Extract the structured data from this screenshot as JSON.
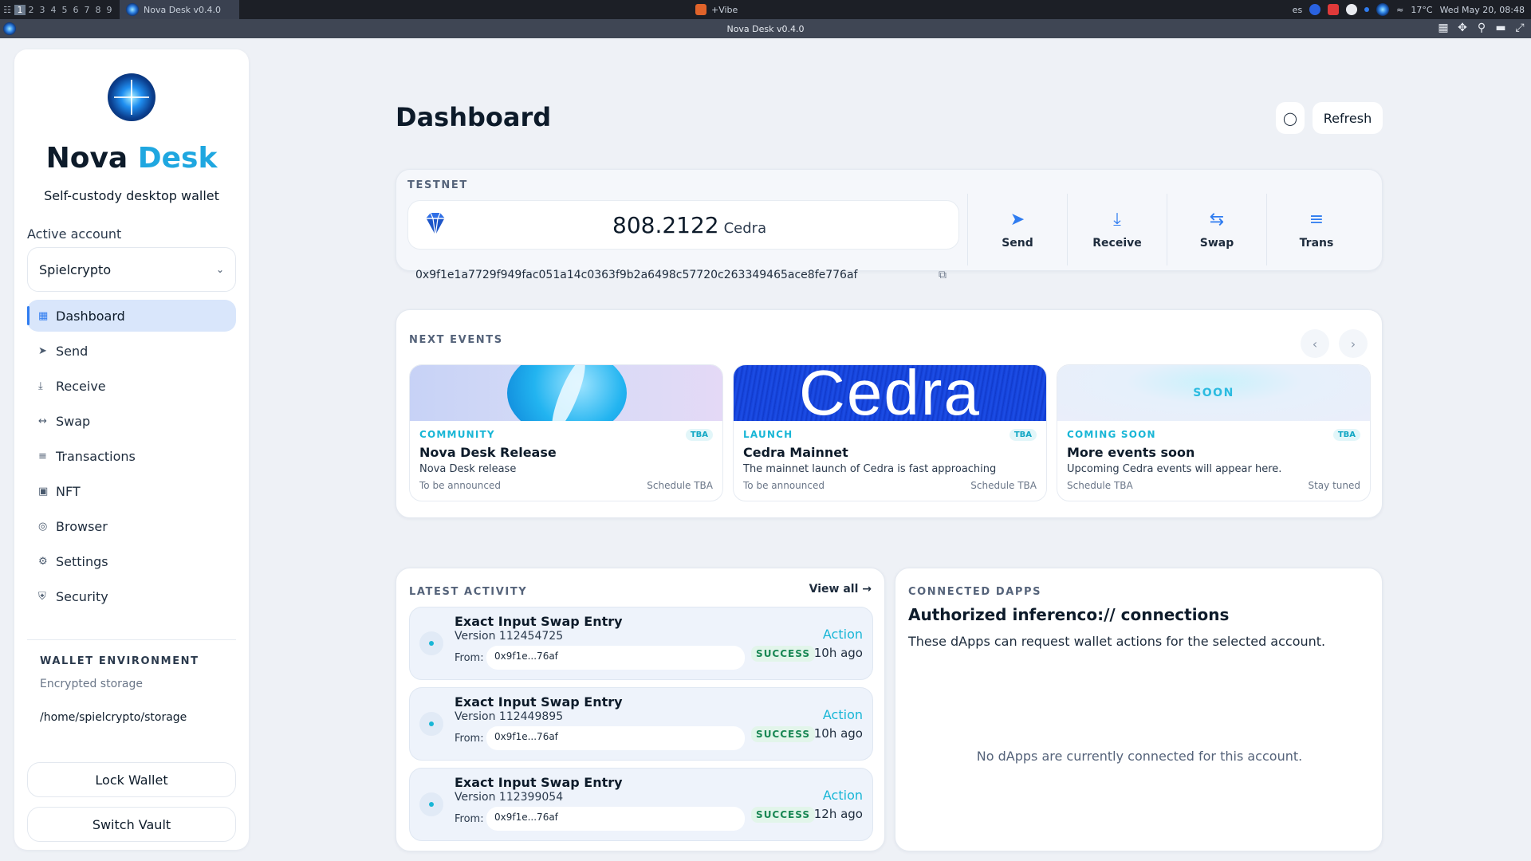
{
  "system": {
    "workspaces": [
      "1",
      "2",
      "3",
      "4",
      "5",
      "6",
      "7",
      "8",
      "9"
    ],
    "window_title": "Nova Desk v0.4.0",
    "center_app": "+Vibe",
    "lang": "es",
    "temp": "17°C",
    "datetime": "Wed May 20, 08:48"
  },
  "titlebar": {
    "title": "Nova Desk v0.4.0"
  },
  "sidebar": {
    "brand_main": "Nova ",
    "brand_accent": "Desk",
    "tagline": "Self-custody desktop wallet",
    "account_label": "Active account",
    "account_value": "Spielcrypto",
    "nav": [
      {
        "label": "Dashboard",
        "icon": "grid-icon"
      },
      {
        "label": "Send",
        "icon": "send-icon"
      },
      {
        "label": "Receive",
        "icon": "download-icon"
      },
      {
        "label": "Swap",
        "icon": "swap-icon"
      },
      {
        "label": "Transactions",
        "icon": "list-icon"
      },
      {
        "label": "NFT",
        "icon": "image-icon"
      },
      {
        "label": "Browser",
        "icon": "globe-icon"
      },
      {
        "label": "Settings",
        "icon": "gear-icon"
      },
      {
        "label": "Security",
        "icon": "shield-icon"
      }
    ],
    "env_label": "WALLET ENVIRONMENT",
    "env_sub": "Encrypted storage",
    "env_path": "/home/spielcrypto/storage",
    "lock_label": "Lock Wallet",
    "switch_label": "Switch Vault"
  },
  "header": {
    "title": "Dashboard",
    "refresh_label": "Refresh"
  },
  "network": {
    "label": "TESTNET",
    "balance": "808.2122",
    "unit": "Cedra",
    "address": "0x9f1e1a7729f949fac051a14c0363f9b2a6498c57720c263349465ace8fe776af",
    "actions": [
      {
        "label": "Send",
        "icon": "send-icon"
      },
      {
        "label": "Receive",
        "icon": "download-icon"
      },
      {
        "label": "Swap",
        "icon": "swap-icon"
      },
      {
        "label": "Trans",
        "icon": "list-icon"
      }
    ]
  },
  "events": {
    "label": "NEXT EVENTS",
    "items": [
      {
        "category": "COMMUNITY",
        "badge": "TBA",
        "title": "Nova Desk Release",
        "desc": "Nova Desk release",
        "date": "To be announced",
        "schedule": "Schedule TBA"
      },
      {
        "category": "LAUNCH",
        "badge": "TBA",
        "title": "Cedra Mainnet",
        "desc": "The mainnet launch of Cedra is fast approaching",
        "date": "To be announced",
        "schedule": "Schedule TBA",
        "banner_text": "Cedra"
      },
      {
        "category": "COMING SOON",
        "badge": "TBA",
        "title": "More events soon",
        "desc": "Upcoming Cedra events will appear here.",
        "date": "Schedule TBA",
        "schedule": "Stay tuned",
        "banner_text": "SOON"
      }
    ]
  },
  "activity": {
    "label": "LATEST ACTIVITY",
    "view_all": "View all",
    "items": [
      {
        "title": "Exact Input Swap Entry",
        "version": "Version 112454725",
        "from_label": "From:",
        "from": "0x9f1e...76af",
        "action": "Action",
        "status": "SUCCESS",
        "ago": "10h ago"
      },
      {
        "title": "Exact Input Swap Entry",
        "version": "Version 112449895",
        "from_label": "From:",
        "from": "0x9f1e...76af",
        "action": "Action",
        "status": "SUCCESS",
        "ago": "10h ago"
      },
      {
        "title": "Exact Input Swap Entry",
        "version": "Version 112399054",
        "from_label": "From:",
        "from": "0x9f1e...76af",
        "action": "Action",
        "status": "SUCCESS",
        "ago": "12h ago"
      }
    ]
  },
  "dapps": {
    "label": "CONNECTED DAPPS",
    "title": "Authorized inferenco:// connections",
    "subtitle": "These dApps can request wallet actions for the selected account.",
    "empty": "No dApps are currently connected for this account."
  },
  "colors": {
    "accent": "#2f7cf0",
    "brand_accent": "#1fa7e0",
    "success": "#198754",
    "cyan": "#19b6d6"
  }
}
